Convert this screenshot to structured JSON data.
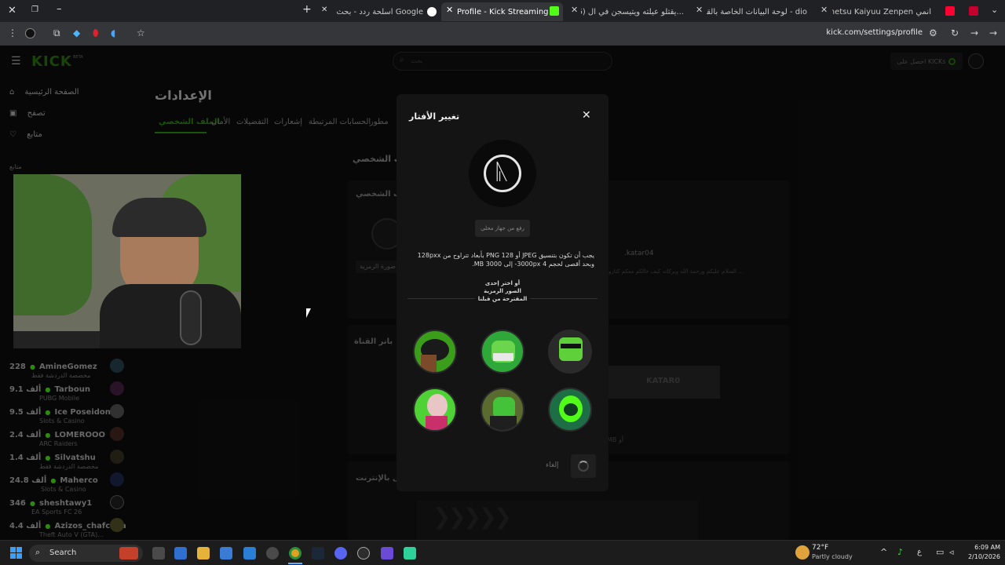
{
  "browser": {
    "tabs": [
      {
        "label": "Shimetsu Kaiyuu Zenpen انمي"
      },
      {
        "label": "لوحة البيانات الخاصة بالقناة - dio"
      },
      {
        "label": "(16) يقتلو عيلته ويتيسجن في ال..."
      },
      {
        "label": "Profile - Kick Streaming"
      },
      {
        "label": "اسلحة ردد - بحث Google"
      }
    ],
    "url": "kick.com/settings/profile"
  },
  "kick": {
    "logo": "KICK",
    "beta": "BETA",
    "search_placeholder": "بحث",
    "get_kicks": "احصل على KICKs",
    "nav": [
      {
        "label": "الصفحة الرئيسية",
        "icon": "home-icon"
      },
      {
        "label": "تصفح",
        "icon": "browse-icon"
      },
      {
        "label": "متابع",
        "icon": "heart-icon"
      }
    ],
    "following_title": "متابع",
    "channels": [
      {
        "count": "228",
        "name": "AmineGomez",
        "game": "مخصصة الدردشة فقط"
      },
      {
        "count": "9.1 ألف",
        "name": "Tarboun",
        "game": "PUBG Mobile"
      },
      {
        "count": "9.5 ألف",
        "name": "Ice Poseidon",
        "game": "Slots & Casino"
      },
      {
        "count": "2.4 ألف",
        "name": "LOMEROOO",
        "game": "ARC Raiders"
      },
      {
        "count": "1.4 ألف",
        "name": "Silvatshu",
        "game": "مخصصة الدردشة فقط"
      },
      {
        "count": "24.8 ألف",
        "name": "Maherco",
        "game": "Slots & Casino"
      },
      {
        "count": "346",
        "name": "sheshtawy1",
        "game": "EA Sports FC 26"
      },
      {
        "count": "4.4 ألف",
        "name": "Azizos_chafchaa",
        "game": "Theft Auto V (GTA)..."
      }
    ],
    "settings_title": "الإعدادات",
    "settings_tabs": [
      "الملف الشخصي",
      "الأمان",
      "التفضيلات",
      "إشعارات",
      "الحسابات المرتبطة",
      "مطور"
    ],
    "bg_profile_section": "ف الشخصي",
    "bg_profile_card": "ف الشخصي",
    "bg_avatar_label": "صورة الرمزية",
    "bg_tiktok": ".katar04",
    "bg_bio": "السلام عليكم ورحمة الله وبركاته كيف حالكم معكم كتارو ...",
    "bg_banner_label": "بانر القناة",
    "bg_banner_text": "KATAR0",
    "bg_mb": "MB أو",
    "bg_offline_label": "ل بالإنترنت"
  },
  "modal": {
    "title": "تغيير الأفتار",
    "upload_button": "رفع من جهاز محلي",
    "requirements": "يجب أن تكون بتنسيق JPEG أو PNG 128 بأبعاد تتراوح من 128pxx وبحد أقصى لحجم 4 3000px- إلى 3000 MB.",
    "divider_text": "أو اختر إحدى الصور الرمزية المقترحة من قبلنا",
    "cancel": "إلغاء",
    "suggested_avatars": 6
  },
  "taskbar": {
    "search": "Search",
    "weather_temp": "72°F",
    "weather_desc": "Partly cloudy",
    "lang": "ع",
    "time": "6:09 AM",
    "date": "2/10/2026"
  },
  "colors": {
    "kick_green": "#53fc18",
    "modal_bg": "#141414",
    "tab_bar": "#202124"
  }
}
